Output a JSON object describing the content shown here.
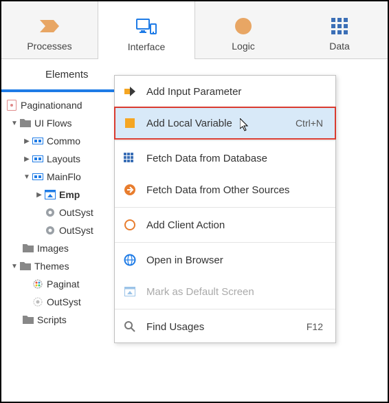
{
  "toolbar": {
    "processes": "Processes",
    "interface": "Interface",
    "logic": "Logic",
    "data": "Data"
  },
  "elements_tab": "Elements",
  "tree": {
    "module": "Paginationand",
    "ui_flows": "UI Flows",
    "common": "Commo",
    "layouts": "Layouts",
    "mainflow": "MainFlo",
    "emp": "Emp",
    "outsys1": "OutSyst",
    "outsys2": "OutSyst",
    "images": "Images",
    "themes": "Themes",
    "paginat": "Paginat",
    "outsyst3": "OutSyst",
    "scripts": "Scripts"
  },
  "menu": {
    "input_param": "Add Input Parameter",
    "local_var": "Add Local Variable",
    "local_var_sc": "Ctrl+N",
    "fetch_db": "Fetch Data from Database",
    "fetch_other": "Fetch Data from Other Sources",
    "client_action": "Add Client Action",
    "open_browser": "Open in Browser",
    "mark_default": "Mark as Default Screen",
    "find_usages": "Find Usages",
    "find_usages_sc": "F12"
  }
}
